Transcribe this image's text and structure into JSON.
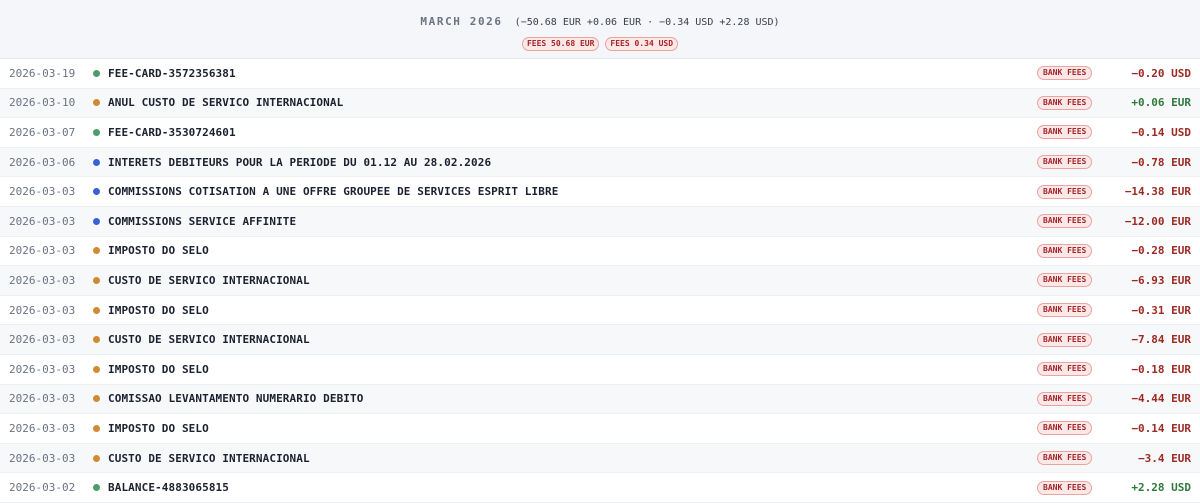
{
  "header": {
    "month": "MARCH 2026",
    "summary": "(−50.68 EUR +0.06 EUR · −0.34 USD +2.28 USD)",
    "badges": [
      "FEES 50.68 EUR",
      "FEES 0.34 USD"
    ]
  },
  "colors": {
    "green": "#4f9a6a",
    "orange": "#d08a32",
    "blue": "#3b5fd6"
  },
  "transactions": [
    {
      "date": "2026-03-19",
      "dot": "green",
      "description": "FEE-CARD-3572356381",
      "tag": "BANK FEES",
      "amount": "−0.20 USD",
      "sign": "neg"
    },
    {
      "date": "2026-03-10",
      "dot": "orange",
      "description": "ANUL CUSTO DE SERVICO INTERNACIONAL",
      "tag": "BANK FEES",
      "amount": "+0.06 EUR",
      "sign": "pos"
    },
    {
      "date": "2026-03-07",
      "dot": "green",
      "description": "FEE-CARD-3530724601",
      "tag": "BANK FEES",
      "amount": "−0.14 USD",
      "sign": "neg"
    },
    {
      "date": "2026-03-06",
      "dot": "blue",
      "description": "INTERETS DEBITEURS POUR LA PERIODE DU 01.12 AU 28.02.2026",
      "tag": "BANK FEES",
      "amount": "−0.78 EUR",
      "sign": "neg"
    },
    {
      "date": "2026-03-03",
      "dot": "blue",
      "description": "COMMISSIONS COTISATION A UNE OFFRE GROUPEE DE SERVICES ESPRIT LIBRE",
      "tag": "BANK FEES",
      "amount": "−14.38 EUR",
      "sign": "neg"
    },
    {
      "date": "2026-03-03",
      "dot": "blue",
      "description": "COMMISSIONS SERVICE AFFINITE",
      "tag": "BANK FEES",
      "amount": "−12.00 EUR",
      "sign": "neg"
    },
    {
      "date": "2026-03-03",
      "dot": "orange",
      "description": "IMPOSTO DO SELO",
      "tag": "BANK FEES",
      "amount": "−0.28 EUR",
      "sign": "neg"
    },
    {
      "date": "2026-03-03",
      "dot": "orange",
      "description": "CUSTO DE SERVICO INTERNACIONAL",
      "tag": "BANK FEES",
      "amount": "−6.93 EUR",
      "sign": "neg"
    },
    {
      "date": "2026-03-03",
      "dot": "orange",
      "description": "IMPOSTO DO SELO",
      "tag": "BANK FEES",
      "amount": "−0.31 EUR",
      "sign": "neg"
    },
    {
      "date": "2026-03-03",
      "dot": "orange",
      "description": "CUSTO DE SERVICO INTERNACIONAL",
      "tag": "BANK FEES",
      "amount": "−7.84 EUR",
      "sign": "neg"
    },
    {
      "date": "2026-03-03",
      "dot": "orange",
      "description": "IMPOSTO DO SELO",
      "tag": "BANK FEES",
      "amount": "−0.18 EUR",
      "sign": "neg"
    },
    {
      "date": "2026-03-03",
      "dot": "orange",
      "description": "COMISSAO LEVANTAMENTO NUMERARIO DEBITO",
      "tag": "BANK FEES",
      "amount": "−4.44 EUR",
      "sign": "neg"
    },
    {
      "date": "2026-03-03",
      "dot": "orange",
      "description": "IMPOSTO DO SELO",
      "tag": "BANK FEES",
      "amount": "−0.14 EUR",
      "sign": "neg"
    },
    {
      "date": "2026-03-03",
      "dot": "orange",
      "description": "CUSTO DE SERVICO INTERNACIONAL",
      "tag": "BANK FEES",
      "amount": "−3.4 EUR",
      "sign": "neg"
    },
    {
      "date": "2026-03-02",
      "dot": "green",
      "description": "BALANCE-4883065815",
      "tag": "BANK FEES",
      "amount": "+2.28 USD",
      "sign": "pos"
    }
  ]
}
